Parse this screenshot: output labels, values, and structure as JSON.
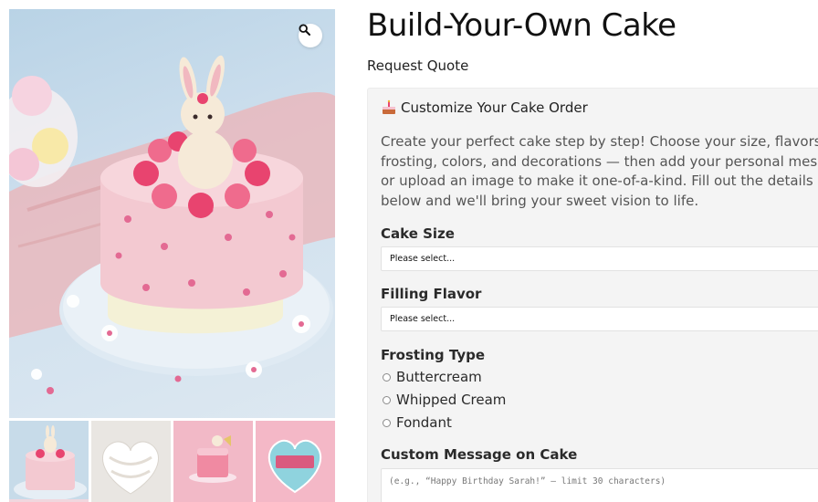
{
  "product": {
    "title": "Build-Your-Own Cake",
    "request_quote": "Request Quote"
  },
  "gallery": {
    "zoom_icon": "search-icon",
    "main_image_alt": "Pink cake with bunny topper",
    "thumbnails": [
      {
        "alt": "Pink bunny cake thumbnail"
      },
      {
        "alt": "White heart cake thumbnail"
      },
      {
        "alt": "Pink slice cake thumbnail"
      },
      {
        "alt": "Blue heart cake thumbnail"
      }
    ]
  },
  "form": {
    "heading": "Customize Your Cake Order",
    "heading_icon": "cake-icon",
    "description": "Create your perfect cake step by step! Choose your size, flavors, frosting, colors, and decorations — then add your personal message or upload an image to make it one-of-a-kind. Fill out the details below and we'll bring your sweet vision to life.",
    "cake_size": {
      "label": "Cake Size",
      "value": "Please select..."
    },
    "filling_flavor": {
      "label": "Filling Flavor",
      "value": "Please select..."
    },
    "frosting_type": {
      "label": "Frosting Type",
      "options": [
        "Buttercream",
        "Whipped Cream",
        "Fondant"
      ]
    },
    "custom_message": {
      "label": "Custom Message on Cake",
      "placeholder": "(e.g., “Happy Birthday Sarah!” — limit 30 characters)"
    }
  }
}
